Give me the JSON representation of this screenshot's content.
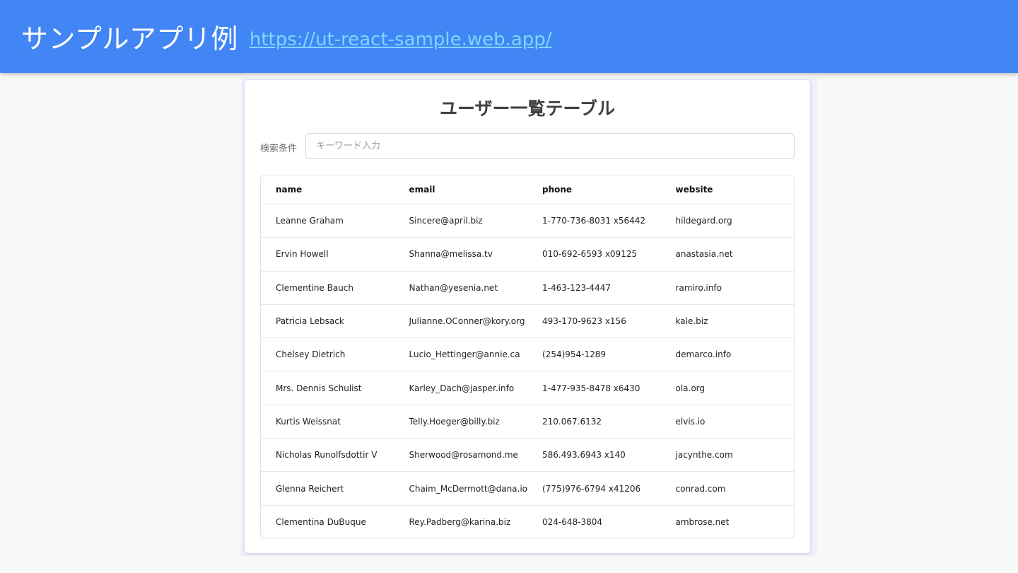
{
  "banner": {
    "title": "サンプルアプリ例",
    "link": "https://ut-react-sample.web.app/"
  },
  "card": {
    "title": "ユーザー一覧テーブル",
    "search_label": "検索条件",
    "search_placeholder": "キーワード入力",
    "search_value": ""
  },
  "table": {
    "headers": [
      "name",
      "email",
      "phone",
      "website"
    ],
    "rows": [
      [
        "Leanne Graham",
        "Sincere@april.biz",
        "1-770-736-8031 x56442",
        "hildegard.org"
      ],
      [
        "Ervin Howell",
        "Shanna@melissa.tv",
        "010-692-6593 x09125",
        "anastasia.net"
      ],
      [
        "Clementine Bauch",
        "Nathan@yesenia.net",
        "1-463-123-4447",
        "ramiro.info"
      ],
      [
        "Patricia Lebsack",
        "Julianne.OConner@kory.org",
        "493-170-9623 x156",
        "kale.biz"
      ],
      [
        "Chelsey Dietrich",
        "Lucio_Hettinger@annie.ca",
        "(254)954-1289",
        "demarco.info"
      ],
      [
        "Mrs. Dennis Schulist",
        "Karley_Dach@jasper.info",
        "1-477-935-8478 x6430",
        "ola.org"
      ],
      [
        "Kurtis Weissnat",
        "Telly.Hoeger@billy.biz",
        "210.067.6132",
        "elvis.io"
      ],
      [
        "Nicholas Runolfsdottir V",
        "Sherwood@rosamond.me",
        "586.493.6943 x140",
        "jacynthe.com"
      ],
      [
        "Glenna Reichert",
        "Chaim_McDermott@dana.io",
        "(775)976-6794 x41206",
        "conrad.com"
      ],
      [
        "Clementina DuBuque",
        "Rey.Padberg@karina.biz",
        "024-648-3804",
        "ambrose.net"
      ]
    ]
  },
  "colors": {
    "banner": "#4285f4",
    "link": "#7fd6ff",
    "background": "#f8f8f8"
  }
}
